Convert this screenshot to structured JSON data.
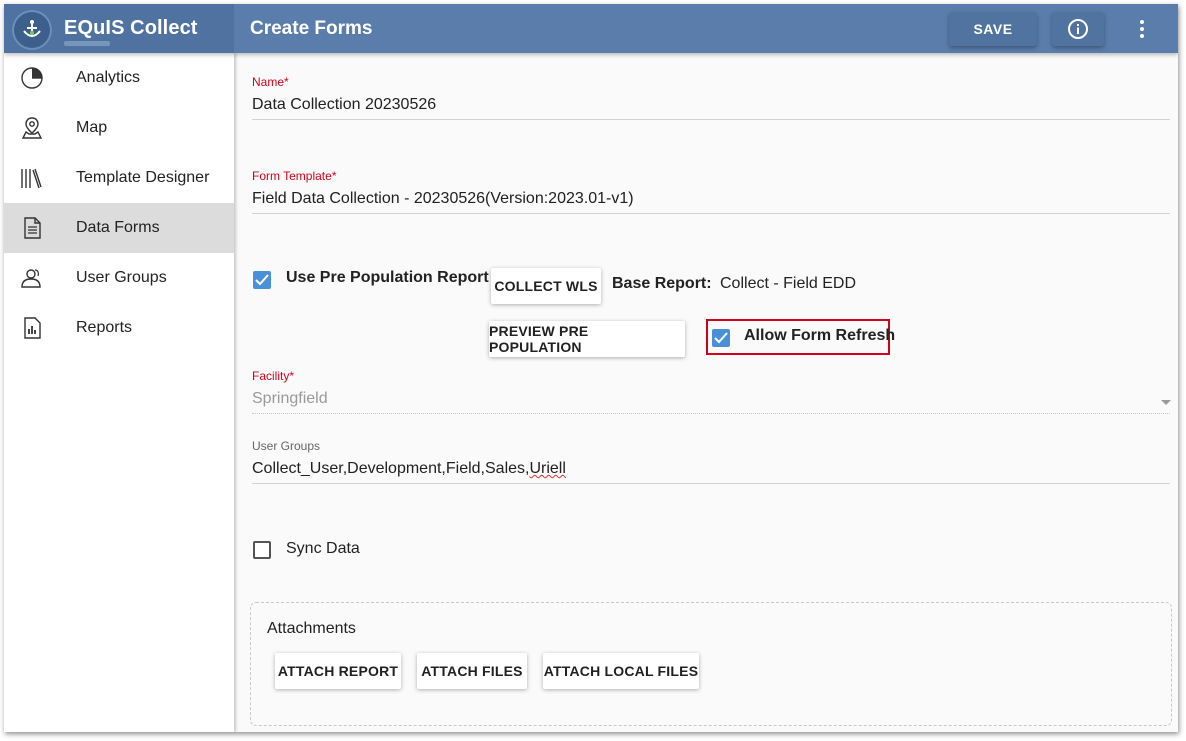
{
  "app": {
    "title": "EQuIS Collect",
    "page_title": "Create Forms"
  },
  "toolbar": {
    "save_label": "SAVE"
  },
  "sidebar": {
    "items": [
      {
        "label": "Analytics",
        "icon": "pie-chart-icon",
        "active": false
      },
      {
        "label": "Map",
        "icon": "map-pin-icon",
        "active": false
      },
      {
        "label": "Template Designer",
        "icon": "library-books-icon",
        "active": false
      },
      {
        "label": "Data Forms",
        "icon": "document-icon",
        "active": true
      },
      {
        "label": "User Groups",
        "icon": "users-icon",
        "active": false
      },
      {
        "label": "Reports",
        "icon": "report-chart-icon",
        "active": false
      }
    ]
  },
  "form": {
    "name": {
      "label": "Name",
      "required_mark": "*",
      "value": "Data Collection 20230526"
    },
    "form_template": {
      "label": "Form Template",
      "required_mark": "*",
      "value": "Field Data Collection - 20230526(Version:2023.01-v1)"
    },
    "use_pre_population": {
      "label": "Use Pre Population Report",
      "checked": true
    },
    "collect_wls_label": "COLLECT WLS",
    "base_report": {
      "label": "Base Report:",
      "value": "Collect - Field EDD"
    },
    "preview_label": "PREVIEW PRE POPULATION",
    "allow_form_refresh": {
      "label": "Allow Form Refresh",
      "checked": true
    },
    "facility": {
      "label": "Facility",
      "required_mark": "*",
      "value": "Springfield"
    },
    "user_groups": {
      "label": "User Groups",
      "value_main": "Collect_User,Development,Field,Sales,",
      "value_flagged": "Uriell"
    },
    "sync_data": {
      "label": "Sync Data",
      "checked": false
    }
  },
  "attachments": {
    "title": "Attachments",
    "buttons": [
      "ATTACH REPORT",
      "ATTACH FILES",
      "ATTACH LOCAL FILES"
    ]
  },
  "colors": {
    "header": "#5a7dab",
    "checkbox": "#4a90d9",
    "required": "#d0021b",
    "highlight": "#d0021b"
  }
}
